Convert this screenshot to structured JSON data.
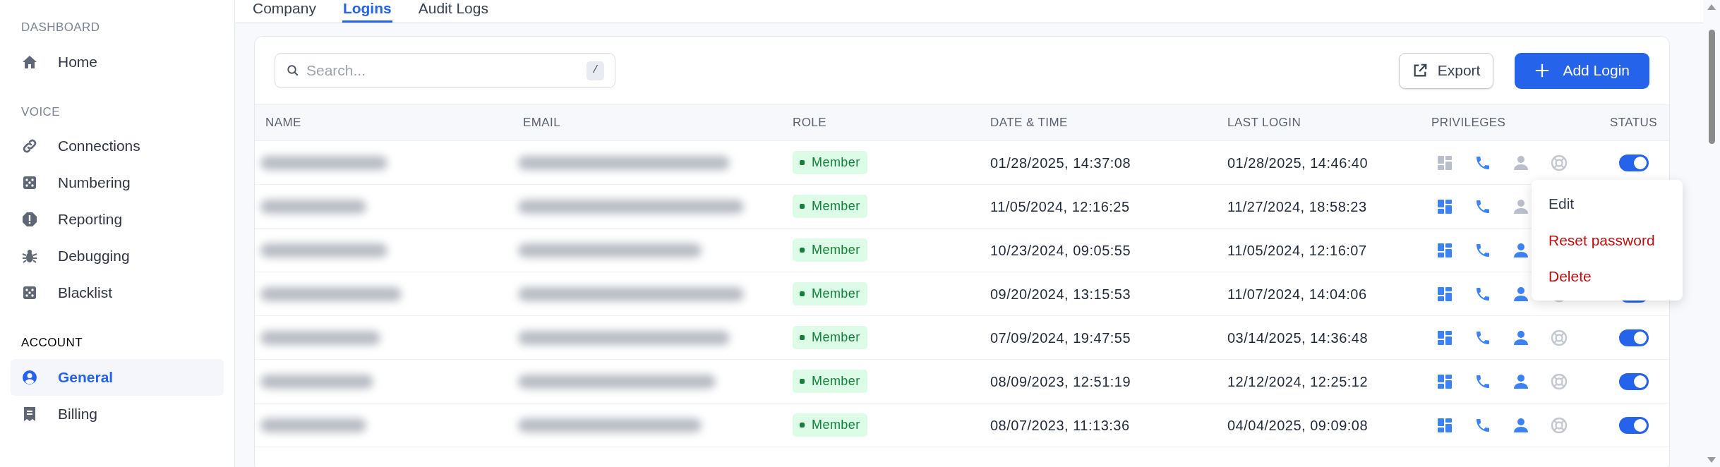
{
  "sidebar": {
    "sections": [
      {
        "title": "DASHBOARD",
        "active": false,
        "items": [
          {
            "label": "Home",
            "selected": false
          }
        ]
      },
      {
        "title": "VOICE",
        "active": false,
        "items": [
          {
            "label": "Connections",
            "selected": false
          },
          {
            "label": "Numbering",
            "selected": false
          },
          {
            "label": "Reporting",
            "selected": false
          },
          {
            "label": "Debugging",
            "selected": false
          },
          {
            "label": "Blacklist",
            "selected": false
          }
        ]
      },
      {
        "title": "ACCOUNT",
        "active": true,
        "items": [
          {
            "label": "General",
            "selected": true
          },
          {
            "label": "Billing",
            "selected": false
          }
        ]
      }
    ]
  },
  "tabs": [
    {
      "label": "Company",
      "selected": false
    },
    {
      "label": "Logins",
      "selected": true
    },
    {
      "label": "Audit Logs",
      "selected": false
    }
  ],
  "search": {
    "placeholder": "Search...",
    "shortcut": "/"
  },
  "buttons": [
    {
      "label": "Export",
      "kind": "secondary"
    },
    {
      "label": "Add Login",
      "kind": "primary"
    }
  ],
  "table": {
    "columns": [
      "NAME",
      "EMAIL",
      "ROLE",
      "DATE & TIME",
      "LAST LOGIN",
      "PRIVILEGES",
      "STATUS"
    ],
    "rows": [
      {
        "role": "Member",
        "created": "01/28/2025, 14:37:08",
        "last_login": "01/28/2025, 14:46:40",
        "privileges": {
          "dashboard": false,
          "calls": true,
          "users": false,
          "support": false
        },
        "enabled": true
      },
      {
        "role": "Member",
        "created": "11/05/2024, 12:16:25",
        "last_login": "11/27/2024, 18:58:23",
        "privileges": {
          "dashboard": true,
          "calls": true,
          "users": false
        }
      },
      {
        "role": "Member",
        "created": "10/23/2024, 09:05:55",
        "last_login": "11/05/2024, 12:16:07",
        "privileges": {
          "dashboard": true,
          "calls": true,
          "users": true
        }
      },
      {
        "role": "Member",
        "created": "09/20/2024, 13:15:53",
        "last_login": "11/07/2024, 14:04:06",
        "privileges": {
          "dashboard": true,
          "calls": true,
          "users": true,
          "support": false
        },
        "enabled": true
      },
      {
        "role": "Member",
        "created": "07/09/2024, 19:47:55",
        "last_login": "03/14/2025, 14:36:48",
        "privileges": {
          "dashboard": true,
          "calls": true,
          "users": true,
          "support": false
        },
        "enabled": true
      },
      {
        "role": "Member",
        "created": "08/09/2023, 12:51:19",
        "last_login": "12/12/2024, 12:25:12",
        "privileges": {
          "dashboard": true,
          "calls": true,
          "users": true,
          "support": false
        },
        "enabled": true
      },
      {
        "role": "Member",
        "created": "08/07/2023, 11:13:36",
        "last_login": "04/04/2025, 09:09:08",
        "privileges": {
          "dashboard": true,
          "calls": true,
          "users": true,
          "support": false
        },
        "enabled": true
      }
    ]
  },
  "row_menu": {
    "items": [
      {
        "label": "Edit",
        "kind": "normal"
      },
      {
        "label": "Reset password",
        "kind": "danger"
      },
      {
        "label": "Delete",
        "kind": "danger"
      }
    ]
  }
}
